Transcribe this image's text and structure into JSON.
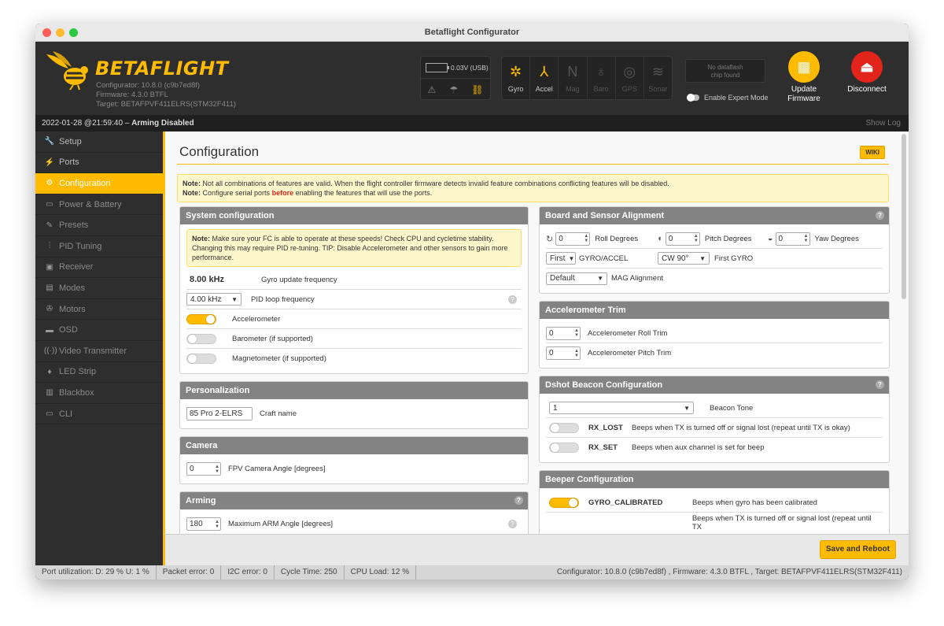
{
  "window": {
    "title": "Betaflight Configurator"
  },
  "header": {
    "brand": "BETAFLIGHT",
    "configurator": "Configurator: 10.8.0 (c9b7ed8f)",
    "firmware": "Firmware: 4.3.0 BTFL",
    "target": "Target: BETAFPVF411ELRS(STM32F411)",
    "battery": "0.03V (USB)",
    "sensors": [
      {
        "label": "Gyro",
        "active": true
      },
      {
        "label": "Accel",
        "active": true
      },
      {
        "label": "Mag",
        "active": false
      },
      {
        "label": "Baro",
        "active": false
      },
      {
        "label": "GPS",
        "active": false
      },
      {
        "label": "Sonar",
        "active": false
      }
    ],
    "dataflash_line1": "No dataflash",
    "dataflash_line2": "chip found",
    "expert_mode": "Enable Expert Mode",
    "update_line1": "Update",
    "update_line2": "Firmware",
    "disconnect": "Disconnect"
  },
  "status": {
    "datetime": "2022-01-28 @21:59:40 –",
    "arming": "Arming Disabled",
    "show_log": "Show Log"
  },
  "sidebar": {
    "items": [
      {
        "label": "Setup",
        "icon": "wrench-icon"
      },
      {
        "label": "Ports",
        "icon": "plug-icon"
      },
      {
        "label": "Configuration",
        "icon": "gear-icon",
        "active": true
      },
      {
        "label": "Power & Battery",
        "icon": "battery-icon"
      },
      {
        "label": "Presets",
        "icon": "wand-icon"
      },
      {
        "label": "PID Tuning",
        "icon": "sliders-icon"
      },
      {
        "label": "Receiver",
        "icon": "receiver-icon"
      },
      {
        "label": "Modes",
        "icon": "modes-icon"
      },
      {
        "label": "Motors",
        "icon": "motor-icon"
      },
      {
        "label": "OSD",
        "icon": "osd-icon"
      },
      {
        "label": "Video Transmitter",
        "icon": "antenna-icon"
      },
      {
        "label": "LED Strip",
        "icon": "led-icon"
      },
      {
        "label": "Blackbox",
        "icon": "blackbox-icon"
      },
      {
        "label": "CLI",
        "icon": "terminal-icon"
      }
    ]
  },
  "page": {
    "title": "Configuration",
    "wiki": "WIKI",
    "note1_label": "Note:",
    "note1_text": "Not all combinations of features are valid. When the flight controller firmware detects invalid feature combinations conflicting features will be disabled.",
    "note2_label": "Note:",
    "note2_pre": "Configure serial ports",
    "note2_bold": "before",
    "note2_post": "enabling the features that will use the ports."
  },
  "system": {
    "title": "System configuration",
    "note_label": "Note:",
    "note_text": "Make sure your FC is able to operate at these speeds! Check CPU and cycletime stability. Changing this may require PID re-tuning. TIP: Disable Accelerometer and other sensors to gain more performance.",
    "gyro_freq_value": "8.00 kHz",
    "gyro_freq_label": "Gyro update frequency",
    "pid_loop_value": "4.00 kHz",
    "pid_loop_label": "PID loop frequency",
    "accelerometer_label": "Accelerometer",
    "barometer_label": "Barometer (if supported)",
    "magnetometer_label": "Magnetometer (if supported)"
  },
  "personalization": {
    "title": "Personalization",
    "craft_name_value": "85 Pro 2-ELRS",
    "craft_name_label": "Craft name"
  },
  "camera": {
    "title": "Camera",
    "angle_value": "0",
    "angle_label": "FPV Camera Angle [degrees]"
  },
  "arming": {
    "title": "Arming",
    "max_angle_value": "180",
    "max_angle_label": "Maximum ARM Angle [degrees]"
  },
  "board": {
    "title": "Board and Sensor Alignment",
    "roll_value": "0",
    "roll_label": "Roll Degrees",
    "pitch_value": "0",
    "pitch_label": "Pitch Degrees",
    "yaw_value": "0",
    "yaw_label": "Yaw Degrees",
    "gyro_sel": "First",
    "gyro_label": "GYRO/ACCEL",
    "gyro_align": "CW 90°",
    "gyro_align_label": "First GYRO",
    "mag_sel": "Default",
    "mag_label": "MAG Alignment"
  },
  "acc_trim": {
    "title": "Accelerometer Trim",
    "roll_value": "0",
    "roll_label": "Accelerometer Roll Trim",
    "pitch_value": "0",
    "pitch_label": "Accelerometer Pitch Trim"
  },
  "dshot": {
    "title": "Dshot Beacon Configuration",
    "tone_value": "1",
    "tone_label": "Beacon Tone",
    "rxlost_name": "RX_LOST",
    "rxlost_desc": "Beeps when TX is turned off or signal lost (repeat until TX is okay)",
    "rxset_name": "RX_SET",
    "rxset_desc": "Beeps when aux channel is set for beep"
  },
  "beeper": {
    "title": "Beeper Configuration",
    "gyro_cal_name": "GYRO_CALIBRATED",
    "gyro_cal_desc": "Beeps when gyro has been calibrated",
    "partial_desc": "Beeps when TX is turned off or signal lost (repeat until TX"
  },
  "footer": {
    "save_reboot": "Save and Reboot"
  },
  "bottom": {
    "port_util": "Port utilization: D: 29 % U: 1 %",
    "packet_error": "Packet error: 0",
    "i2c_error": "I2C error: 0",
    "cycle_time": "Cycle Time: 250",
    "cpu_load": "CPU Load: 12 %",
    "version_info": "Configurator: 10.8.0 (c9b7ed8f) , Firmware: 4.3.0 BTFL , Target: BETAFPVF411ELRS(STM32F411)"
  },
  "colors": {
    "accent": "#ffbb00",
    "dark_bg": "#2e2e2e",
    "panel_head": "#838383",
    "danger": "#e2241a"
  }
}
